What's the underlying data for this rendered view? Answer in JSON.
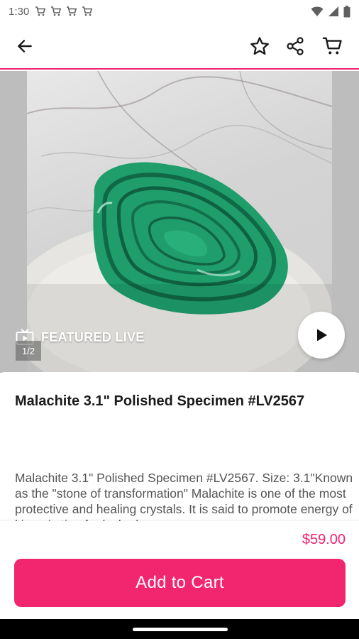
{
  "status_bar": {
    "time": "1:30",
    "notification_icons": [
      "cart-notification-icon",
      "cart-notification-icon",
      "cart-notification-icon",
      "cart-notification-icon"
    ],
    "right_icons": [
      "wifi-icon",
      "signal-icon",
      "battery-icon"
    ]
  },
  "app_bar": {
    "icons": [
      "back-arrow-icon",
      "star-icon",
      "share-icon",
      "cart-icon"
    ],
    "accent_color": "#f0226f"
  },
  "hero": {
    "badge_label": "FEATURED LIVE",
    "page_indicator": "1/2",
    "play_icon": "play-icon"
  },
  "product": {
    "title": "Malachite 3.1\" Polished Specimen #LV2567",
    "description": "Malachite 3.1\" Polished Specimen #LV2567. Size: 3.1\"Known as the \"stone of transformation\" Malachite is one of the most protective and healing crystals. It is said to promote energy of kin ania tion for lacked…"
  },
  "purchase": {
    "price": "$59.00",
    "button_label": "Add to Cart",
    "button_color": "#f2256f"
  }
}
